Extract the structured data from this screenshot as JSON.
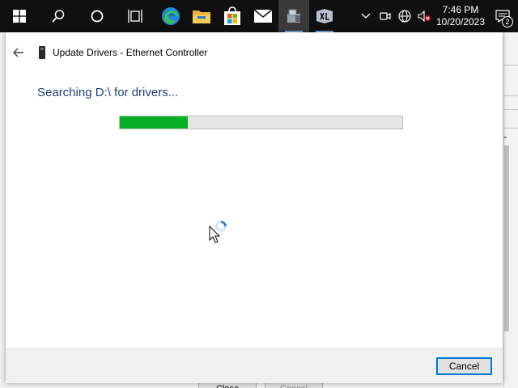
{
  "taskbar": {
    "items": [
      {
        "icon": "windows-start-icon"
      },
      {
        "icon": "search-icon"
      },
      {
        "icon": "cortana-icon"
      },
      {
        "icon": "task-view-icon"
      },
      {
        "icon": "edge-icon"
      },
      {
        "icon": "file-explorer-icon"
      },
      {
        "icon": "microsoft-store-icon"
      },
      {
        "icon": "mail-icon"
      },
      {
        "icon": "device-manager-icon"
      },
      {
        "icon": "app-icon"
      }
    ],
    "tray_icons": [
      "chevron-up-icon",
      "meet-now-icon",
      "network-icon",
      "volume-muted-icon"
    ],
    "time": "7:46 PM",
    "date": "10/20/2023",
    "notification_count": "2"
  },
  "background_window": {
    "close_label": "Close",
    "cancel_label": "Cancel"
  },
  "dialog": {
    "title": "Update Drivers - Ethernet Controller",
    "status": "Searching D:\\ for drivers...",
    "progress_percent": 24,
    "cancel_label": "Cancel"
  },
  "colors": {
    "taskbar": "#101010",
    "progress_fill": "#06b025",
    "status_text": "#1e3f7a",
    "focus_accent": "#0078d7"
  }
}
